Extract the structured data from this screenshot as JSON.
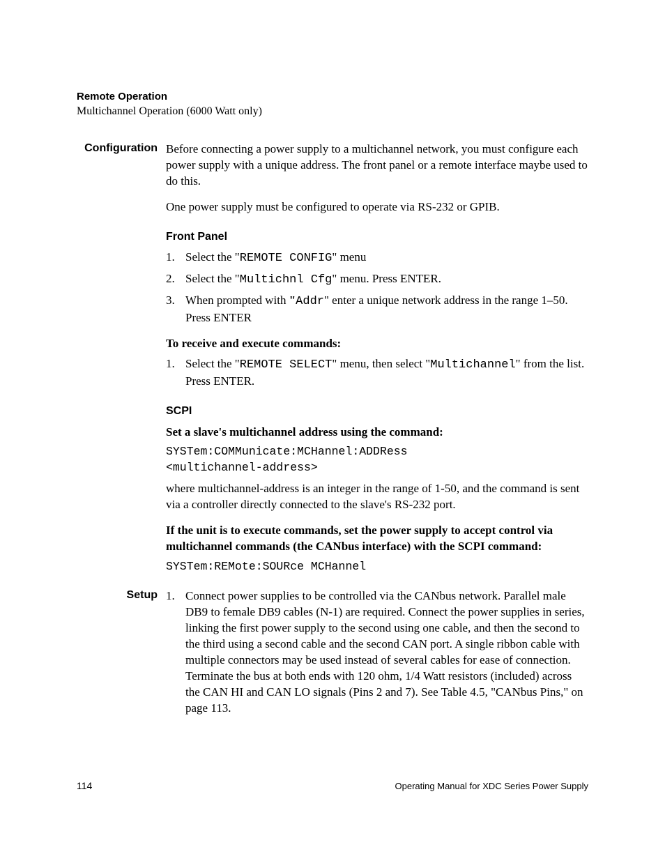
{
  "header": {
    "title": "Remote Operation",
    "subtitle": "Multichannel Operation (6000 Watt only)"
  },
  "configuration": {
    "label": "Configuration",
    "intro": "Before connecting a power supply to a multichannel network, you must configure each power supply with a unique address. The front panel or a remote interface maybe used to do this.",
    "note": "One power supply must be configured to operate via RS-232 or GPIB.",
    "front_panel": {
      "heading": "Front Panel",
      "steps": [
        {
          "html": "Select the \"<span class='mono'>REMOTE CONFIG</span>\" menu"
        },
        {
          "html": "Select the \"<span class='mono'>Multichnl Cfg</span>\" menu. Press ENTER."
        },
        {
          "html": "When prompted with <b>\"</b><span class='mono'>Addr</span>\" enter a unique network address in the range 1–50. Press ENTER"
        }
      ]
    },
    "receive_exec": {
      "heading": "To receive and execute commands:",
      "steps": [
        {
          "html": "Select the \"<span class='mono'>REMOTE SELECT</span>\" menu, then select \"<span class='mono'>Multichannel</span>\" from the list. Press ENTER."
        }
      ]
    },
    "scpi": {
      "heading": "SCPI",
      "set_slave_heading": "Set a slave's multichannel address using the command:",
      "set_slave_cmd": "SYSTem:COMMunicate:MCHannel:ADDRess\n<multichannel-address>",
      "where_text": "where multichannel-address is an integer in the range of 1-50, and the command is sent via a controller directly connected to the slave's RS-232 port.",
      "if_unit_heading": "If the unit is to execute commands, set the power supply to accept control via multichannel commands (the CANbus interface) with the SCPI command:",
      "if_unit_cmd": "SYSTem:REMote:SOURce MCHannel"
    }
  },
  "setup": {
    "label": "Setup",
    "steps": [
      {
        "html": "Connect power supplies to be controlled via the CANbus network. Parallel male DB9 to female DB9 cables (N-1) are required. Connect the power supplies in series, linking the first power supply to the second using one cable, and then the second to the third using a second cable and the second CAN port. A single ribbon cable with multiple connectors may be used instead of several cables for ease of connection. Terminate the bus at both ends with 120 ohm, 1/4 Watt resistors (included) across the CAN HI and CAN LO signals (Pins 2 and 7). See Table 4.5, \"CANbus Pins,\" on page 113."
      }
    ]
  },
  "footer": {
    "page_number": "114",
    "doc_title": "Operating Manual for XDC Series Power Supply"
  }
}
